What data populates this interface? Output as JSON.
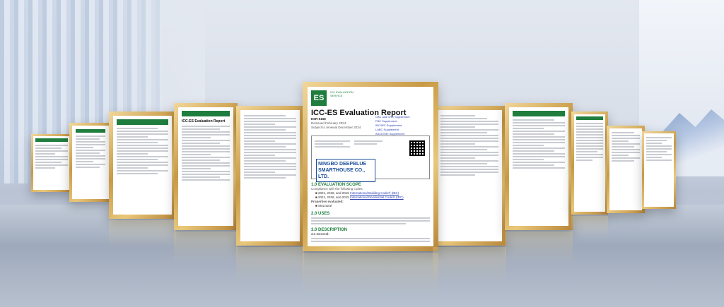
{
  "center_report": {
    "logo_letters": "ES",
    "logo_tagline": "ICC EVALUATION SERVICE",
    "title": "ICC-ES Evaluation Report",
    "report_number": "ESR-5168",
    "dates": [
      "Reissued February 2024",
      "Subject to renewal December 2024"
    ],
    "right_links": [
      "CBC and CRC Supplement",
      "FBC Supplement",
      "IBC/IRC Supplement",
      "LABC Supplement",
      "ASCE/SEI Supplement"
    ],
    "company": "NINGBO DEEPBLUE SMARTHOUSE CO., LTD.",
    "sections": {
      "scope": "1.0 EVALUATION SCOPE",
      "uses": "2.0 USES",
      "description": "3.0 DESCRIPTION",
      "general": "3.1 General:"
    },
    "scope_intro": "Compliance with the following codes:",
    "scope_items": [
      {
        "text": "2021, 2018, and 2015 ",
        "link": "International Building Code® (IBC)"
      },
      {
        "text": "2021, 2018, and 2015 ",
        "link": "International Residential Code® (IRC)"
      }
    ],
    "properties_label": "Properties evaluated:",
    "properties": [
      "Structural"
    ]
  },
  "side_report": {
    "title": "ICC-ES Evaluation Report"
  }
}
